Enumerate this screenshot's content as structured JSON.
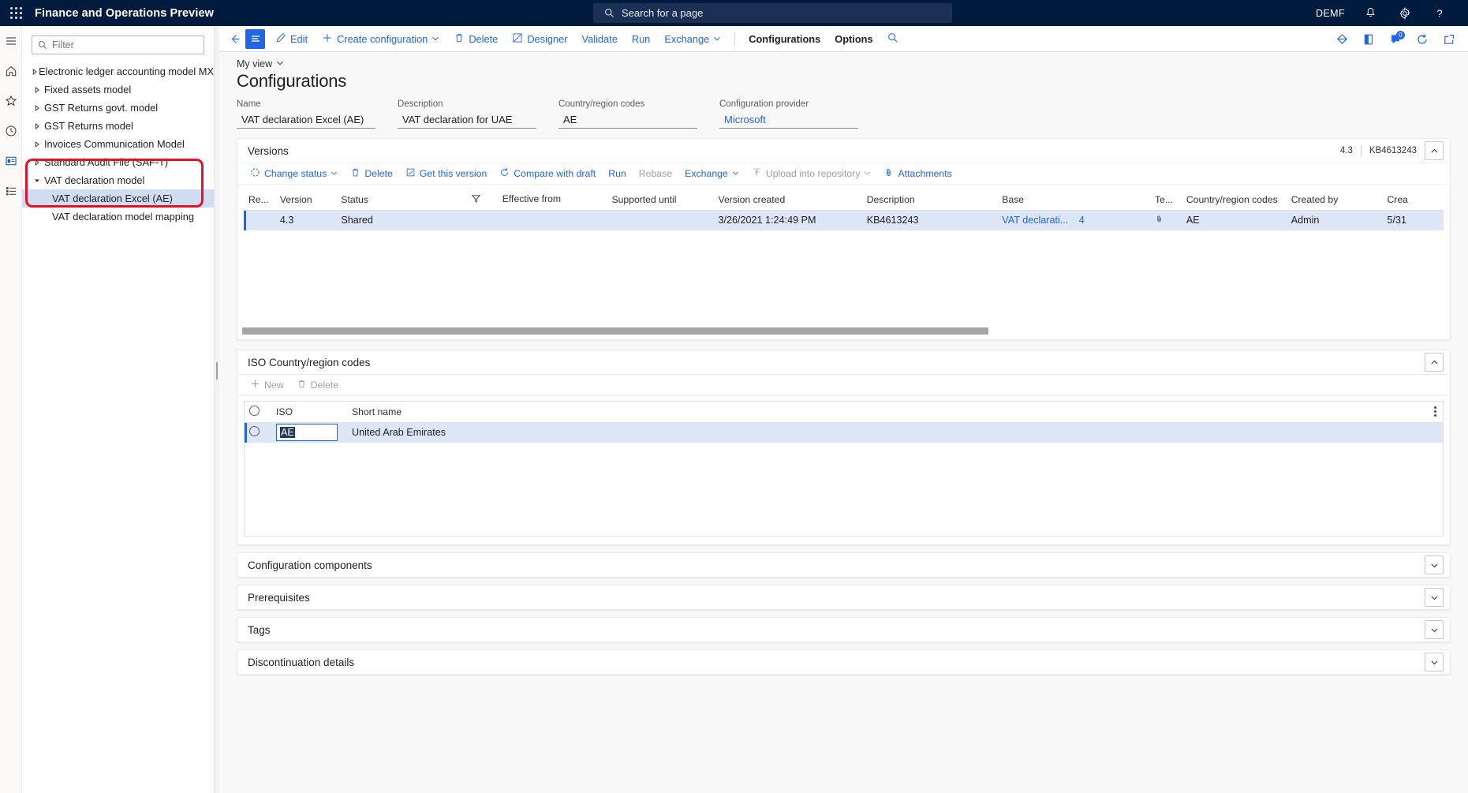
{
  "topnav": {
    "app_title": "Finance and Operations Preview",
    "search_placeholder": "Search for a page",
    "company": "DEMF",
    "icons": [
      "waffle-icon",
      "search-icon",
      "bell-icon",
      "gear-icon",
      "help-icon"
    ]
  },
  "rail": {
    "items": [
      {
        "name": "hamburger-icon"
      },
      {
        "name": "home-icon"
      },
      {
        "name": "favorites-star-icon"
      },
      {
        "name": "recent-clock-icon"
      },
      {
        "name": "workspaces-icon"
      },
      {
        "name": "modules-list-icon"
      }
    ]
  },
  "tree": {
    "filter_placeholder": "Filter",
    "nodes": [
      {
        "label": "Electronic ledger accounting model MX",
        "level": 0,
        "expanded": false,
        "selected": false
      },
      {
        "label": "Fixed assets model",
        "level": 0,
        "expanded": false,
        "selected": false
      },
      {
        "label": "GST Returns govt. model",
        "level": 0,
        "expanded": false,
        "selected": false
      },
      {
        "label": "GST Returns model",
        "level": 0,
        "expanded": false,
        "selected": false
      },
      {
        "label": "Invoices Communication Model",
        "level": 0,
        "expanded": false,
        "selected": false
      },
      {
        "label": "Standard Audit File (SAF-T)",
        "level": 0,
        "expanded": false,
        "selected": false
      },
      {
        "label": "VAT declaration model",
        "level": 0,
        "expanded": true,
        "selected": false
      },
      {
        "label": "VAT declaration Excel (AE)",
        "level": 1,
        "expanded": false,
        "selected": true
      },
      {
        "label": "VAT declaration model mapping",
        "level": 1,
        "expanded": false,
        "selected": false
      }
    ],
    "highlight_color": "#e81123"
  },
  "toolbar": {
    "back_label": "",
    "show_list_label": "",
    "edit": "Edit",
    "create_configuration": "Create configuration",
    "delete": "Delete",
    "designer": "Designer",
    "validate": "Validate",
    "run": "Run",
    "exchange": "Exchange",
    "configurations": "Configurations",
    "options": "Options",
    "search": "",
    "notification_count": "0"
  },
  "page": {
    "view_selector": "My view",
    "title": "Configurations",
    "fields": [
      {
        "label": "Name",
        "value": "VAT declaration Excel (AE)",
        "link": false
      },
      {
        "label": "Description",
        "value": "VAT declaration for UAE",
        "link": false
      },
      {
        "label": "Country/region codes",
        "value": "AE",
        "link": false
      },
      {
        "label": "Configuration provider",
        "value": "Microsoft",
        "link": true
      }
    ]
  },
  "versions": {
    "title": "Versions",
    "header_version": "4.3",
    "header_kb": "KB4613243",
    "toolbar": [
      {
        "label": "Change status",
        "icon": "change-status-icon",
        "caret": true,
        "disabled": false
      },
      {
        "label": "Delete",
        "icon": "trash-icon",
        "caret": false,
        "disabled": false
      },
      {
        "label": "Get this version",
        "icon": "get-version-icon",
        "caret": false,
        "disabled": false
      },
      {
        "label": "Compare with draft",
        "icon": "compare-icon",
        "caret": false,
        "disabled": false
      },
      {
        "label": "Run",
        "icon": "",
        "caret": false,
        "disabled": false
      },
      {
        "label": "Rebase",
        "icon": "",
        "caret": false,
        "disabled": true
      },
      {
        "label": "Exchange",
        "icon": "",
        "caret": true,
        "disabled": false
      },
      {
        "label": "Upload into repository",
        "icon": "upload-icon",
        "caret": true,
        "disabled": true
      },
      {
        "label": "Attachments",
        "icon": "attachment-icon",
        "caret": false,
        "disabled": false
      }
    ],
    "columns": [
      "Re...",
      "Version",
      "Status",
      "Effective from",
      "Supported until",
      "Version created",
      "Description",
      "Base",
      "Te...",
      "Country/region codes",
      "Created by",
      "Crea"
    ],
    "rows": [
      {
        "re": "",
        "version": "4.3",
        "status": "Shared",
        "effective_from": "",
        "supported_until": "",
        "version_created": "3/26/2021 1:24:49 PM",
        "description": "KB4613243",
        "base": "VAT declarati...",
        "base_num": "4",
        "te": "attachment-icon",
        "country_codes": "AE",
        "created_by": "Admin",
        "crea": "5/31"
      }
    ]
  },
  "iso": {
    "title": "ISO Country/region codes",
    "toolbar": [
      {
        "label": "New",
        "icon": "plus-icon",
        "disabled": true
      },
      {
        "label": "Delete",
        "icon": "trash-icon",
        "disabled": true
      }
    ],
    "columns": [
      "",
      "ISO",
      "Short name"
    ],
    "rows": [
      {
        "iso": "AE",
        "short_name": "United Arab Emirates",
        "selected": true,
        "editing": true
      }
    ]
  },
  "collapsed_sections": [
    {
      "title": "Configuration components"
    },
    {
      "title": "Prerequisites"
    },
    {
      "title": "Tags"
    },
    {
      "title": "Discontinuation details"
    }
  ]
}
